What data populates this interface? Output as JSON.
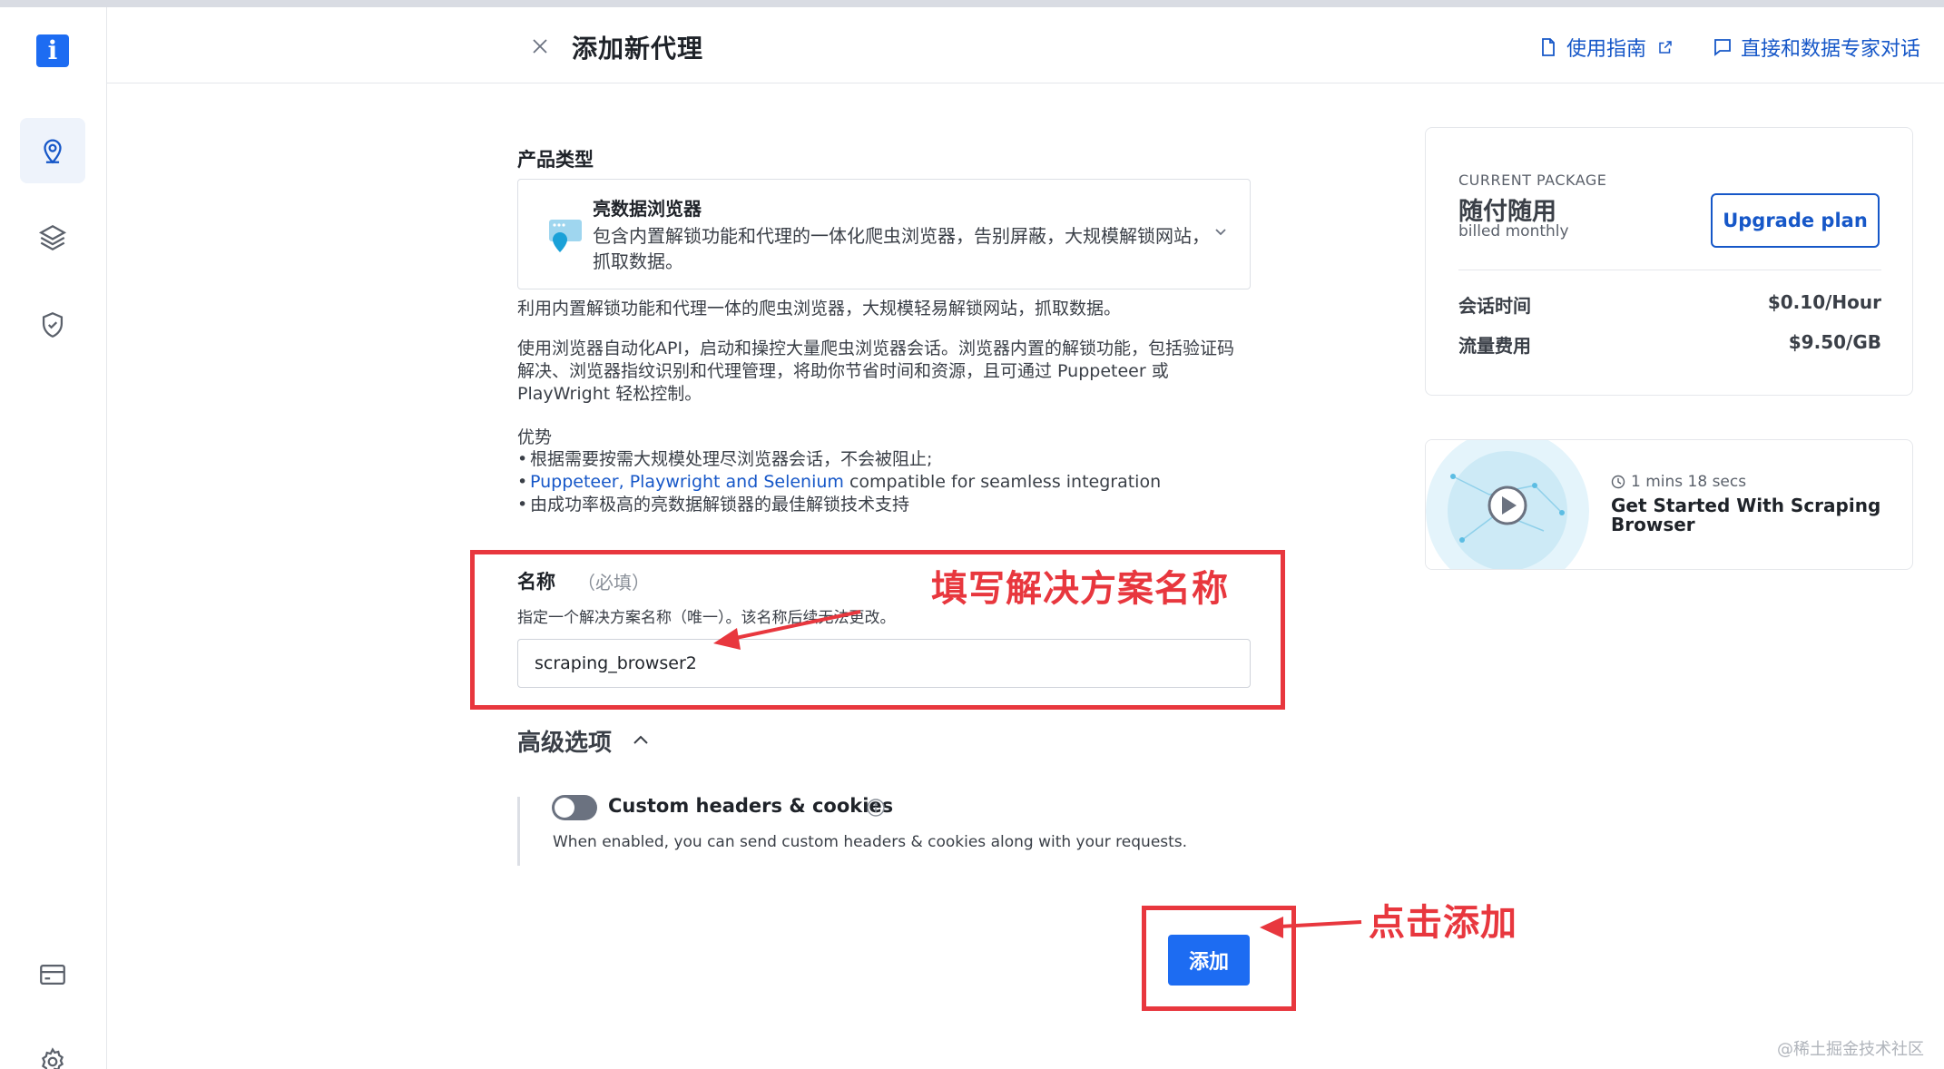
{
  "header": {
    "title": "添加新代理",
    "guide_link": "使用指南",
    "expert_link": "直接和数据专家对话"
  },
  "sidebar": {
    "logo_glyph": "i",
    "icons": [
      "location-pin-icon",
      "layers-icon",
      "shield-check-icon",
      "billing-card-icon",
      "settings-gear-icon"
    ]
  },
  "product": {
    "section_label": "产品类型",
    "name": "亮数据浏览器",
    "card_desc": "包含内置解锁功能和代理的一体化爬虫浏览器，告别屏蔽，大规模解锁网站，抓取数据。",
    "summary": "利用内置解锁功能和代理一体的爬虫浏览器，大规模轻易解锁网站，抓取数据。",
    "detail": "使用浏览器自动化API，启动和操控大量爬虫浏览器会话。浏览器内置的解锁功能，包括验证码解决、浏览器指纹识别和代理管理，将助你节省时间和资源，且可通过 Puppeteer 或 PlayWright 轻松控制。",
    "advantages_label": "优势",
    "advantages": [
      {
        "text": "根据需要按需大规模处理尽浏览器会话，不会被阻止;"
      },
      {
        "link": "Puppeteer, Playwright and Selenium",
        "text": " compatible for seamless integration"
      },
      {
        "text": "由成功率极高的亮数据解锁器的最佳解锁技术支持"
      }
    ]
  },
  "name_field": {
    "label": "名称",
    "required": "（必填）",
    "hint": "指定一个解决方案名称（唯一）。该名称后续无法更改。",
    "value": "scraping_browser2"
  },
  "advanced": {
    "label": "高级选项",
    "toggle_label": "Custom headers & cookies",
    "toggle_on": false,
    "toggle_desc": "When enabled, you can send custom headers & cookies along with your requests."
  },
  "add_button": "添加",
  "package": {
    "caption": "CURRENT PACKAGE",
    "name": "随付随用",
    "billing": "billed monthly",
    "upgrade": "Upgrade plan",
    "rows": [
      {
        "label": "会话时间",
        "value": "$0.10/Hour"
      },
      {
        "label": "流量费用",
        "value": "$9.50/GB"
      }
    ]
  },
  "video": {
    "duration": "1 mins 18 secs",
    "title": "Get Started With Scraping Browser"
  },
  "annotations": {
    "name_note": "填写解决方案名称",
    "click_note": "点击添加"
  },
  "watermark": "@稀土掘金技术社区",
  "colors": {
    "primary": "#1d6cf2",
    "link": "#1657c8",
    "annotation": "#e8373e"
  }
}
